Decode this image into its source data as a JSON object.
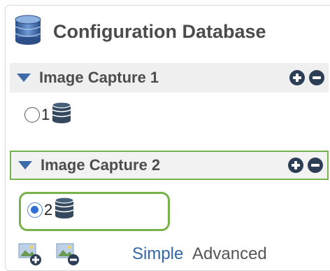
{
  "header": {
    "title": "Configuration Database",
    "icon": "database-icon"
  },
  "sections": [
    {
      "label": "Image Capture 1",
      "items": [
        {
          "number": "1",
          "selected": false
        }
      ]
    },
    {
      "label": "Image Capture 2",
      "items": [
        {
          "number": "2",
          "selected": true
        }
      ]
    }
  ],
  "footer": {
    "add_icon": "add-image-icon",
    "remove_icon": "remove-image-icon",
    "simple_label": "Simple",
    "advanced_label": "Advanced"
  },
  "colors": {
    "accent_blue": "#3d6aa8",
    "selection_green": "#77b24a",
    "button_dark": "#2b3e56",
    "radio_blue": "#2f6fd1"
  }
}
